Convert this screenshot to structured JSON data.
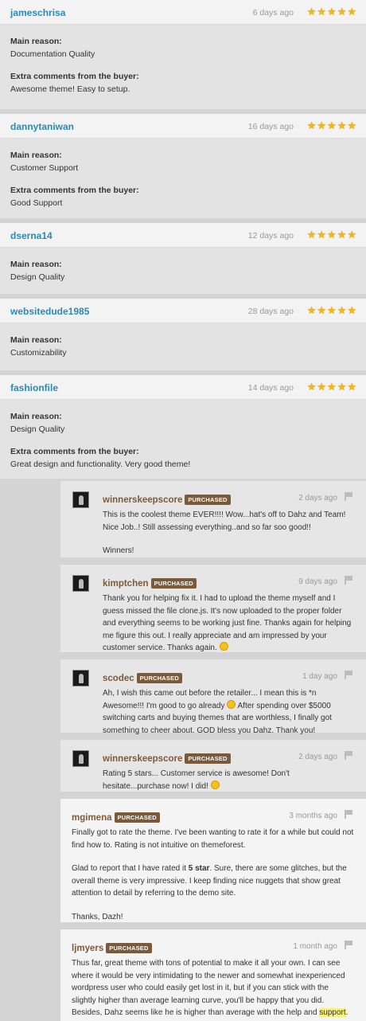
{
  "reviews": [
    {
      "user": "jameschrisa",
      "date": "6 days ago",
      "reason_label": "Main reason:",
      "reason": "Documentation Quality",
      "comments_label": "Extra comments from the buyer:",
      "comments": "Awesome theme! Easy to setup."
    },
    {
      "user": "dannytaniwan",
      "date": "16 days ago",
      "reason_label": "Main reason:",
      "reason": "Customer Support",
      "comments_label": "Extra comments from the buyer:",
      "comments": "Good Support"
    },
    {
      "user": "dserna14",
      "date": "12 days ago",
      "reason_label": "Main reason:",
      "reason": "Design Quality"
    },
    {
      "user": "websitedude1985",
      "date": "28 days ago",
      "reason_label": "Main reason:",
      "reason": "Customizability"
    },
    {
      "user": "fashionfile",
      "date": "14 days ago",
      "reason_label": "Main reason:",
      "reason": "Design Quality",
      "comments_label": "Extra comments from the buyer:",
      "comments": "Great design and functionality. Very good theme!"
    }
  ],
  "rating": {
    "stars": 5,
    "max": 5,
    "color": "#f3b612"
  },
  "badge_label": "PURCHASED",
  "comments": [
    {
      "user": "winnerskeepscore",
      "date": "2 days ago",
      "p1": "This is the coolest theme EVER!!!! Wow...hat's off to Dahz and Team! Nice Job..! Still assessing everything..and so far soo good!!",
      "p2": "Winners!"
    },
    {
      "user": "kimptchen",
      "date": "9 days ago",
      "p1": "Thank you for helping fix it. I had to upload the theme myself and I guess missed the file clone.js. It's now uploaded to the proper folder and everything seems to be working just fine. Thanks again for helping me figure this out. I really appreciate and am impressed by your customer service. Thanks again."
    },
    {
      "user": "scodec",
      "date": "1 day ago",
      "p1a": "Ah, I wish this came out before the retailer... I mean this is *n Awesome!!! I'm good to go already",
      "p1b": "After spending over $5000 switching carts and buying themes that are worthless, I finally got something to cheer about. GOD bless you Dahz. Thank you!"
    },
    {
      "user": "winnerskeepscore",
      "date": "2 days ago",
      "p1": "Rating 5 stars... Customer service is awesome! Don't hesitate...purchase now! I did!"
    },
    {
      "user": "mgimena",
      "date": "3 months ago",
      "p1": "Finally got to rate the theme. I've been wanting to rate it for a while but could not find how to. Rating is not intuitive on themeforest.",
      "p2a": "Glad to report that I have rated it",
      "p2b": "5 star",
      "p2c": ". Sure, there are some glitches, but the overall theme is very impressive. I keep finding nice nuggets that show great attention to detail by referring to the demo site.",
      "p3": "Thanks, Dazh!"
    },
    {
      "user": "ljmyers",
      "date": "1 month ago",
      "p1a": "Thus far, great theme with tons of potential to make it all your own. I can see where it would be very intimidating to the newer and somewhat inexperienced wordpress user who could easily get lost in it, but if you can stick with the slightly higher than average learning curve, you'll be happy that you did. Besides, Dahz seems like he is higher than average with the help and",
      "p1b": "support",
      "p1c": "."
    }
  ]
}
